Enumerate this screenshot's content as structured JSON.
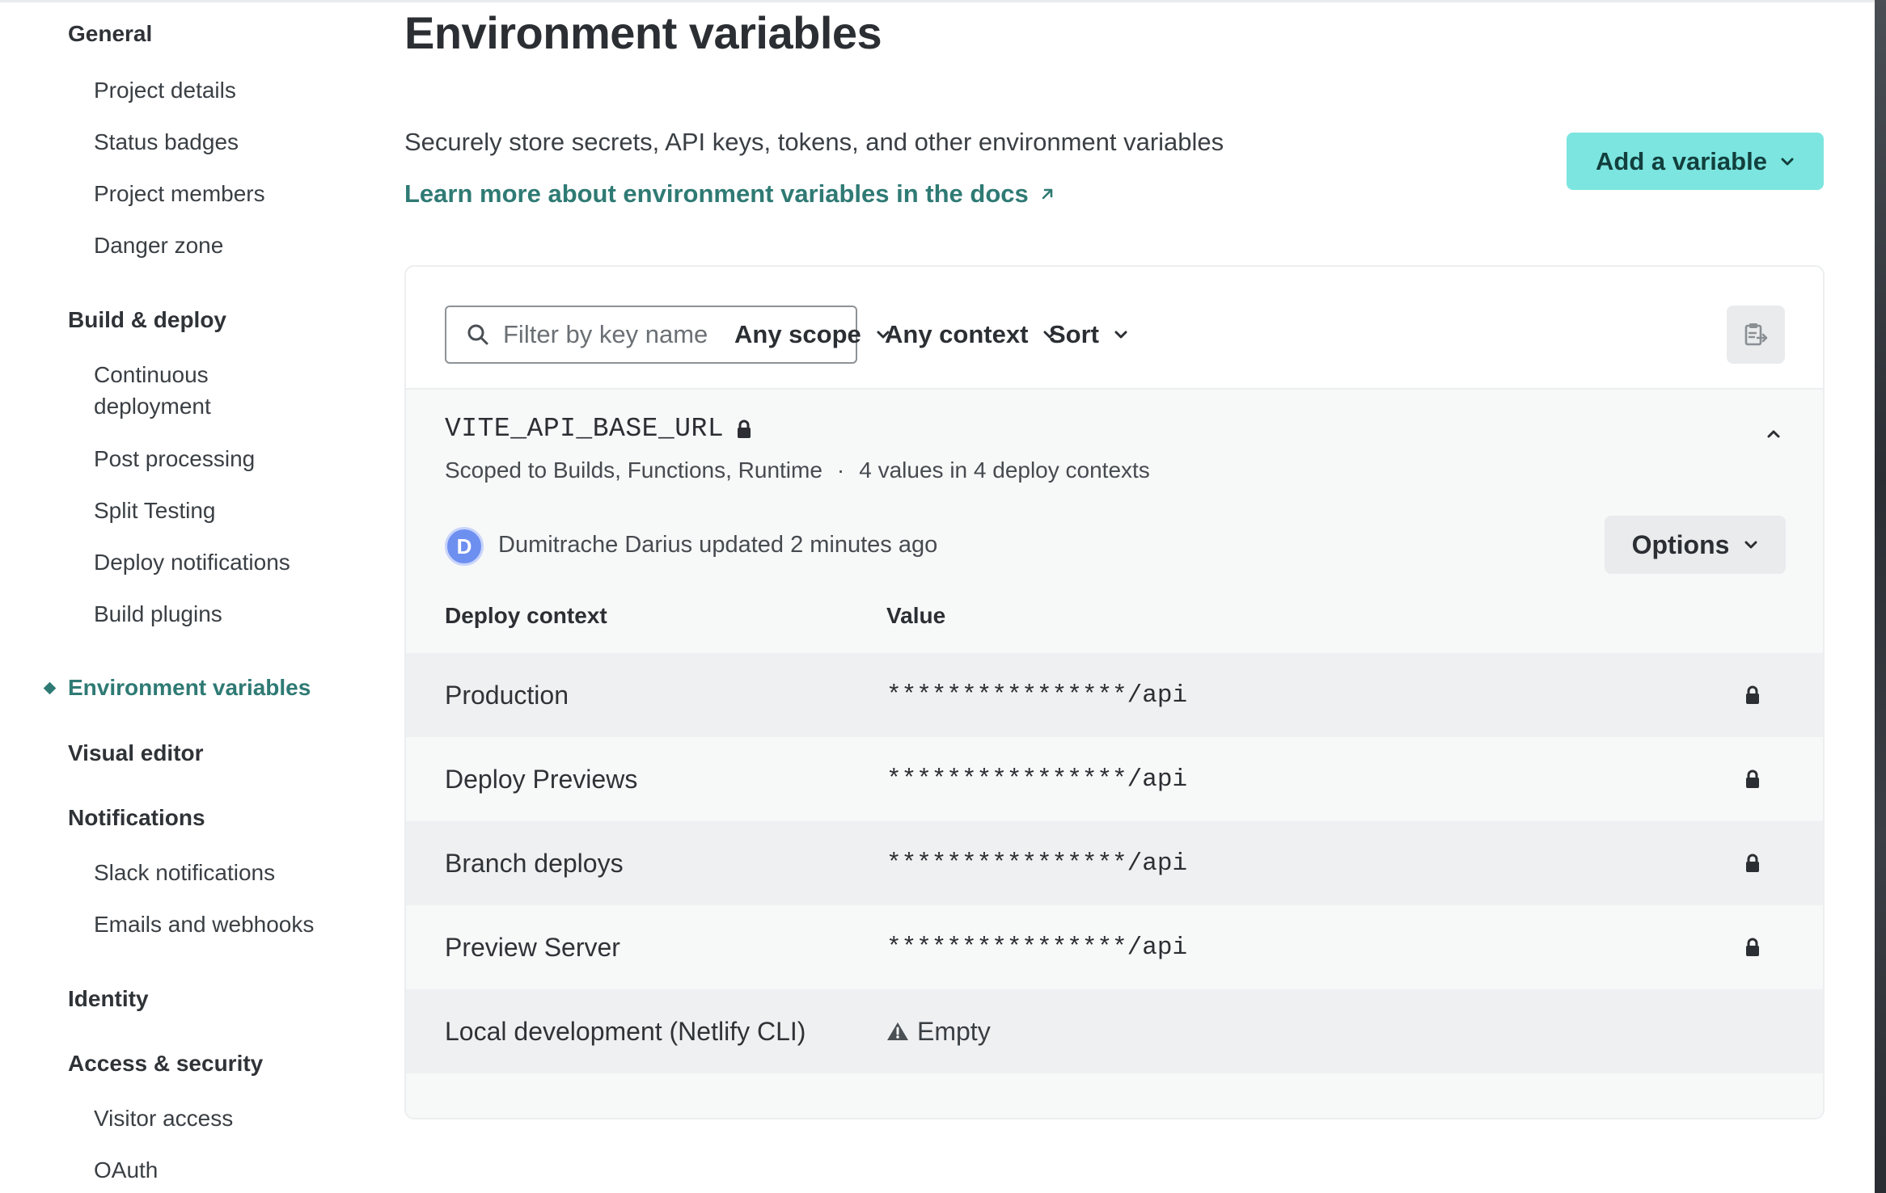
{
  "sidebar": {
    "sections": [
      {
        "label": "General"
      },
      {
        "label": "Build & deploy"
      },
      {
        "label": "Visual editor"
      },
      {
        "label": "Notifications"
      },
      {
        "label": "Identity"
      },
      {
        "label": "Access & security"
      }
    ],
    "general_items": [
      "Project details",
      "Status badges",
      "Project members",
      "Danger zone"
    ],
    "build_items": [
      "Continuous deployment",
      "Post processing",
      "Split Testing",
      "Deploy notifications",
      "Build plugins"
    ],
    "active_item": "Environment variables",
    "notification_items": [
      "Slack notifications",
      "Emails and webhooks"
    ],
    "access_items": [
      "Visitor access",
      "OAuth"
    ]
  },
  "main": {
    "title": "Environment variables",
    "description": "Securely store secrets, API keys, tokens, and other environment variables",
    "docs_link": "Learn more about environment variables in the docs",
    "add_button": "Add a variable"
  },
  "toolbar": {
    "filter_placeholder": "Filter by key name",
    "scope_label": "Any scope",
    "context_label": "Any context",
    "sort_label": "Sort"
  },
  "variable": {
    "key": "VITE_API_BASE_URL",
    "scopes": "Scoped to Builds, Functions, Runtime",
    "separator": "·",
    "values_summary": "4 values in 4 deploy contexts",
    "avatar_initial": "D",
    "updated_text": "Dumitrache Darius updated 2 minutes ago",
    "options_label": "Options",
    "table_headers": {
      "context": "Deploy context",
      "value": "Value"
    },
    "rows": [
      {
        "context": "Production",
        "value": "****************/api",
        "locked": true
      },
      {
        "context": "Deploy Previews",
        "value": "****************/api",
        "locked": true
      },
      {
        "context": "Branch deploys",
        "value": "****************/api",
        "locked": true
      },
      {
        "context": "Preview Server",
        "value": "****************/api",
        "locked": true
      },
      {
        "context": "Local development (Netlify CLI)",
        "value": "Empty",
        "locked": false
      }
    ]
  },
  "colors": {
    "accent": "#2f7a74",
    "add_button_bg": "#7ce5e0",
    "avatar": "#6d8ff0"
  }
}
